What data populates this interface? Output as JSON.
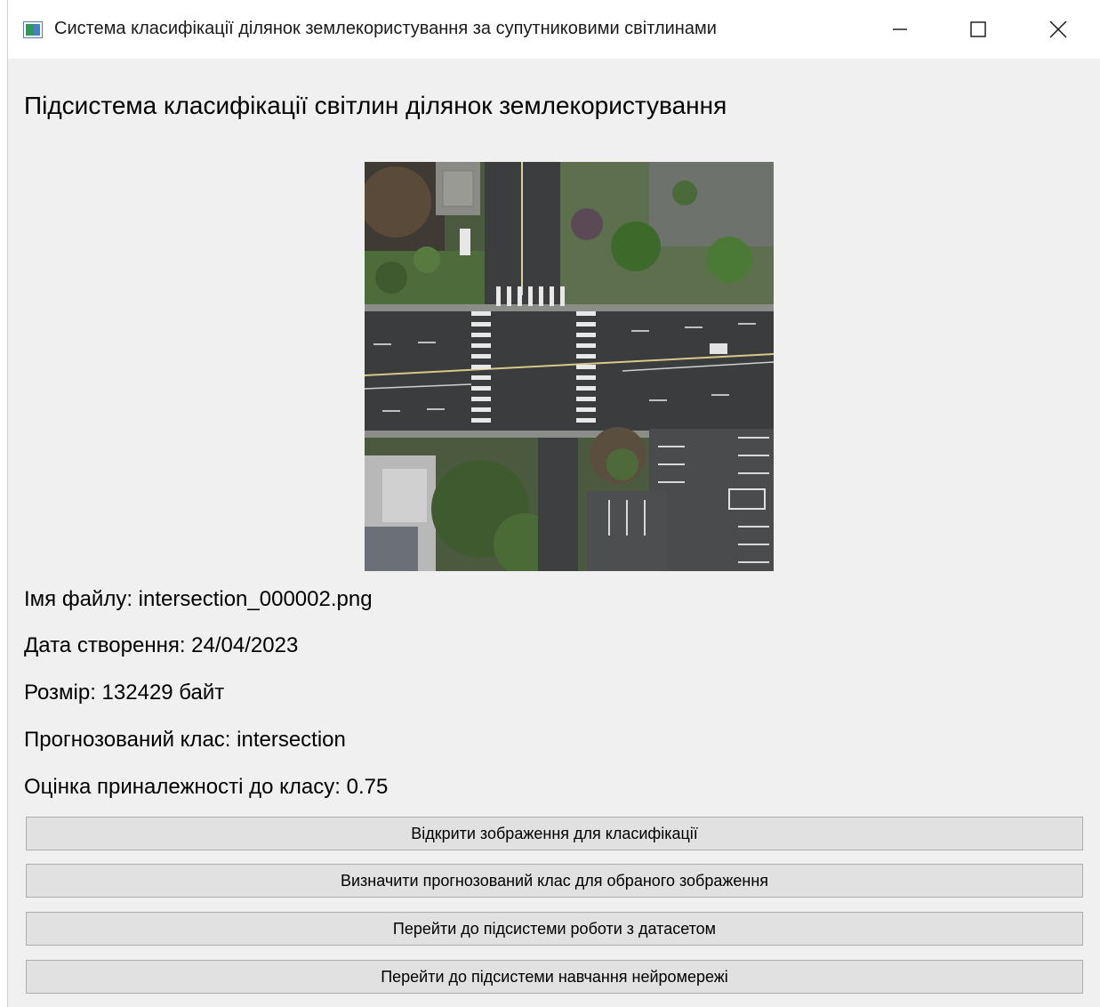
{
  "window": {
    "title": "Система класифікації ділянок землекористування за супутниковими світлинами",
    "controls": [
      "minimize-icon",
      "maximize-icon",
      "close-icon"
    ]
  },
  "main": {
    "heading": "Підсистема класифікації світлин ділянок землекористування",
    "image": {
      "description_icon": "satellite-image-intersection"
    },
    "info": {
      "file_name": "Імя файлу: intersection_000002.png",
      "created": "Дата створення: 24/04/2023",
      "size": "Розмір: 132429 байт",
      "predicted_class": "Прогнозований клас: intersection",
      "score": "Оцінка приналежності до класу: 0.75"
    },
    "buttons": {
      "open_image": "Відкрити зображення для класифікації",
      "predict": "Визначити прогнозований клас для обраного зображення",
      "goto_dataset": "Перейти до підсистеми роботи з датасетом",
      "goto_training": "Перейти до підсистеми навчання нейромережі"
    }
  }
}
